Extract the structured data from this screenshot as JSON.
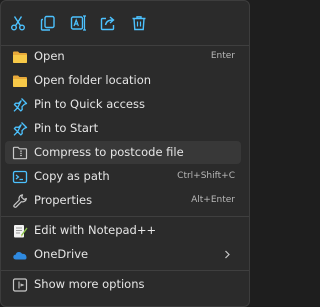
{
  "toolbar": {
    "buttons": [
      {
        "name": "cut-icon"
      },
      {
        "name": "copy-icon"
      },
      {
        "name": "rename-icon"
      },
      {
        "name": "share-icon"
      },
      {
        "name": "delete-icon"
      }
    ]
  },
  "items": [
    {
      "label": "Open",
      "shortcut": "Enter",
      "icon": "folder-icon"
    },
    {
      "label": "Open folder location",
      "shortcut": "",
      "icon": "folder-icon"
    },
    {
      "label": "Pin to Quick access",
      "shortcut": "",
      "icon": "pin-icon"
    },
    {
      "label": "Pin to Start",
      "shortcut": "",
      "icon": "pin-icon"
    },
    {
      "label": "Compress to postcode file",
      "shortcut": "",
      "icon": "zip-folder-icon"
    },
    {
      "label": "Copy as path",
      "shortcut": "Ctrl+Shift+C",
      "icon": "copy-path-icon"
    },
    {
      "label": "Properties",
      "shortcut": "Alt+Enter",
      "icon": "wrench-icon"
    },
    {
      "label": "Edit with Notepad++",
      "shortcut": "",
      "icon": "notepad-plus-plus-icon"
    },
    {
      "label": "OneDrive",
      "shortcut": "",
      "icon": "onedrive-cloud-icon"
    },
    {
      "label": "Show more options",
      "shortcut": "",
      "icon": "more-options-icon"
    }
  ],
  "colors": {
    "menu_bg": "#2b2b2b",
    "hover_bg": "#383838",
    "accent_blue": "#4cc2ff",
    "folder_yellow": "#f4c542",
    "text": "#e6e6e6"
  }
}
